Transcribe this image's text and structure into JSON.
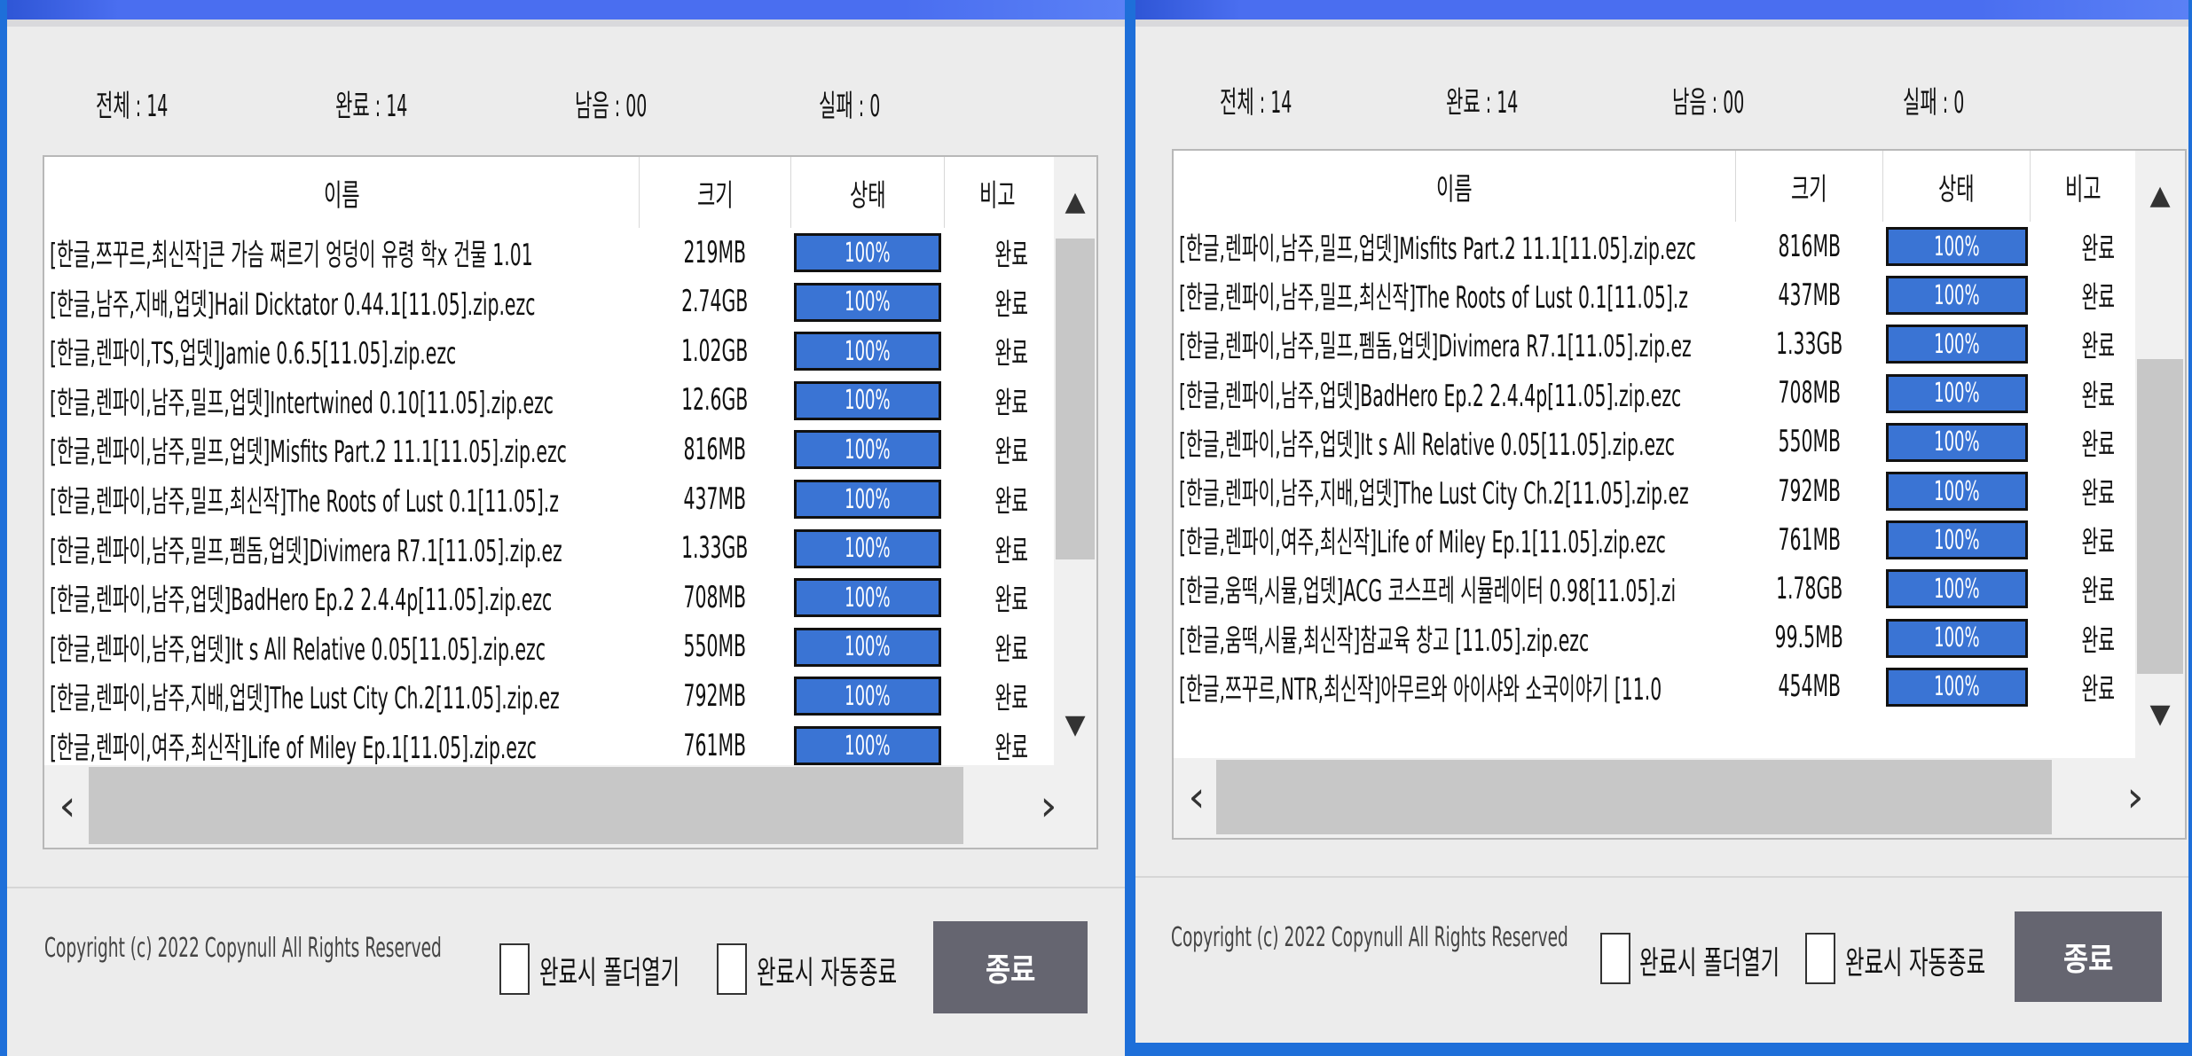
{
  "stats": {
    "total": "전체 : 14",
    "done": "완료 : 14",
    "remaining": "남음 : 00",
    "failed": "실패 : 0"
  },
  "columns": {
    "name": "이름",
    "size": "크기",
    "status": "상태",
    "note": "비고"
  },
  "left_rows": [
    {
      "name": "[한글,쯔꾸르,최신작]큰 가슴 쩌르기 엉덩이 유령 학x 건물 1.01",
      "size": "219MB",
      "status": "100%",
      "note": "완료"
    },
    {
      "name": "[한글,남주,지배,업뎃]Hail Dicktator 0.44.1[11.05].zip.ezc",
      "size": "2.74GB",
      "status": "100%",
      "note": "완료"
    },
    {
      "name": "[한글,렌파이,TS,업뎃]Jamie 0.6.5[11.05].zip.ezc",
      "size": "1.02GB",
      "status": "100%",
      "note": "완료"
    },
    {
      "name": "[한글,렌파이,남주,밀프,업뎃]Intertwined 0.10[11.05].zip.ezc",
      "size": "12.6GB",
      "status": "100%",
      "note": "완료"
    },
    {
      "name": "[한글,렌파이,남주,밀프,업뎃]Misfits Part.2 11.1[11.05].zip.ezc",
      "size": "816MB",
      "status": "100%",
      "note": "완료"
    },
    {
      "name": "[한글,렌파이,남주,밀프,최신작]The Roots of Lust 0.1[11.05].z",
      "size": "437MB",
      "status": "100%",
      "note": "완료"
    },
    {
      "name": "[한글,렌파이,남주,밀프,펨돔,업뎃]Divimera R7.1[11.05].zip.ez",
      "size": "1.33GB",
      "status": "100%",
      "note": "완료"
    },
    {
      "name": "[한글,렌파이,남주,업뎃]BadHero Ep.2 2.4.4p[11.05].zip.ezc",
      "size": "708MB",
      "status": "100%",
      "note": "완료"
    },
    {
      "name": "[한글,렌파이,남주,업뎃]It s All Relative 0.05[11.05].zip.ezc",
      "size": "550MB",
      "status": "100%",
      "note": "완료"
    },
    {
      "name": "[한글,렌파이,남주,지배,업뎃]The Lust City Ch.2[11.05].zip.ez",
      "size": "792MB",
      "status": "100%",
      "note": "완료"
    },
    {
      "name": "[한글,렌파이,여주,최신작]Life of Miley Ep.1[11.05].zip.ezc",
      "size": "761MB",
      "status": "100%",
      "note": "완료"
    }
  ],
  "right_rows": [
    {
      "name": "[한글,렌파이,남주,밀프,업뎃]Misfits Part.2 11.1[11.05].zip.ezc",
      "size": "816MB",
      "status": "100%",
      "note": "완료"
    },
    {
      "name": "[한글,렌파이,남주,밀프,최신작]The Roots of Lust 0.1[11.05].z",
      "size": "437MB",
      "status": "100%",
      "note": "완료"
    },
    {
      "name": "[한글,렌파이,남주,밀프,펨돔,업뎃]Divimera R7.1[11.05].zip.ez",
      "size": "1.33GB",
      "status": "100%",
      "note": "완료"
    },
    {
      "name": "[한글,렌파이,남주,업뎃]BadHero Ep.2 2.4.4p[11.05].zip.ezc",
      "size": "708MB",
      "status": "100%",
      "note": "완료"
    },
    {
      "name": "[한글,렌파이,남주,업뎃]It s All Relative 0.05[11.05].zip.ezc",
      "size": "550MB",
      "status": "100%",
      "note": "완료"
    },
    {
      "name": "[한글,렌파이,남주,지배,업뎃]The Lust City Ch.2[11.05].zip.ez",
      "size": "792MB",
      "status": "100%",
      "note": "완료"
    },
    {
      "name": "[한글,렌파이,여주,최신작]Life of Miley Ep.1[11.05].zip.ezc",
      "size": "761MB",
      "status": "100%",
      "note": "완료"
    },
    {
      "name": "[한글,움떡,시뮬,업뎃]ACG 코스프레 시뮬레이터 0.98[11.05].zi",
      "size": "1.78GB",
      "status": "100%",
      "note": "완료"
    },
    {
      "name": "[한글,움떡,시뮬,최신작]참교육 창고 [11.05].zip.ezc",
      "size": "99.5MB",
      "status": "100%",
      "note": "완료"
    },
    {
      "name": "[한글,쯔꾸르,NTR,최신작]아무르와 아이샤와 소국이야기 [11.0",
      "size": "454MB",
      "status": "100%",
      "note": "완료"
    }
  ],
  "footer": {
    "copyright": "Copyright (c) 2022 Copynull All Rights Reserved",
    "open_folder_label": "완료시 폴더열기",
    "auto_close_label": "완료시 자동종료",
    "close_button": "종료"
  },
  "icons": {
    "scroll_up": "▲",
    "scroll_down": "▼",
    "scroll_left": "‹",
    "scroll_right": "›"
  },
  "colors": {
    "accent": "#1e6fd9",
    "progress": "#3a74d4",
    "close_button": "#656570"
  }
}
